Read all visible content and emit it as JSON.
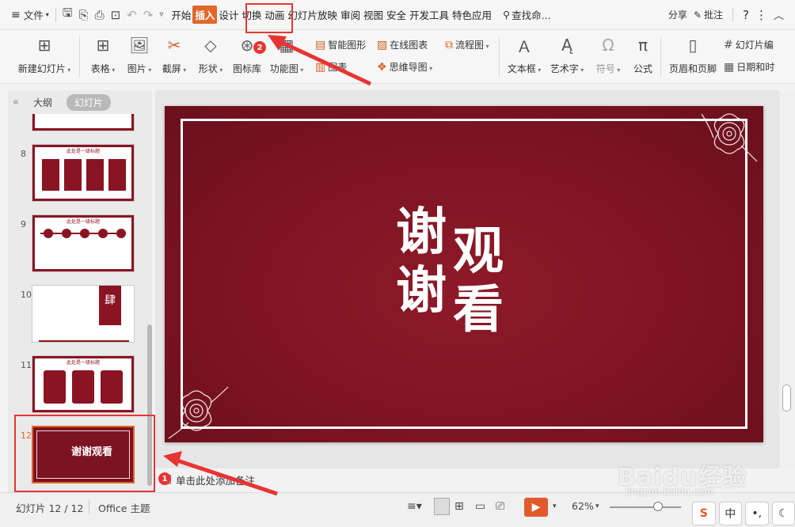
{
  "menubar": {
    "file_label": "文件",
    "tabs": [
      {
        "label": "开始",
        "active": false
      },
      {
        "label": "插入",
        "active": true
      },
      {
        "label": "设计",
        "active": false
      },
      {
        "label": "切换",
        "active": false
      },
      {
        "label": "动画",
        "active": false
      },
      {
        "label": "幻灯片放映",
        "active": false
      },
      {
        "label": "审阅",
        "active": false
      },
      {
        "label": "视图",
        "active": false
      },
      {
        "label": "安全",
        "active": false
      },
      {
        "label": "开发工具",
        "active": false
      },
      {
        "label": "特色应用",
        "active": false
      }
    ],
    "search_label": "查找命...",
    "share_label": "分享",
    "comment_label": "批注",
    "help_label": "?"
  },
  "ribbon": {
    "new_slide": "新建幻灯片",
    "table": "表格",
    "picture": "图片",
    "screenshot": "截屏",
    "shape": "形状",
    "icon_lib": "图标库",
    "func_chart": "功能图",
    "smart_graphic": "智能图形",
    "chart": "图表",
    "online_chart": "在线图表",
    "mind_map": "思维导图",
    "flowchart": "流程图",
    "textbox": "文本框",
    "art_text": "艺术字",
    "symbol": "符号",
    "formula": "公式",
    "header_footer": "页眉和页脚",
    "slide_number": "幻灯片编",
    "date_time": "日期和时"
  },
  "left_panel": {
    "tab_outline": "大纲",
    "tab_slides": "幻灯片",
    "thumbnails": [
      {
        "number": "8",
        "title": "此处是一级标题"
      },
      {
        "number": "9",
        "title": "此处是一级标题"
      },
      {
        "number": "10",
        "title": "肆"
      },
      {
        "number": "11",
        "title": "此处是一级标题"
      },
      {
        "number": "12",
        "title": "谢谢观看"
      }
    ]
  },
  "slide": {
    "chars": [
      "谢",
      "谢",
      "观",
      "看"
    ]
  },
  "notes": {
    "placeholder": "单击此处添加备注"
  },
  "status": {
    "slide_counter": "幻灯片 12 / 12",
    "theme": "Office 主题",
    "zoom": "62%"
  },
  "annotations": {
    "badge1": "1",
    "badge2": "2"
  },
  "watermark": {
    "main": "Baidu经验",
    "sub": "jingyan.baidu.com"
  },
  "ime": {
    "zh": "中"
  },
  "colors": {
    "accent": "#e0662c",
    "slide_bg": "#7b1322",
    "annotation_red": "#e83434"
  }
}
